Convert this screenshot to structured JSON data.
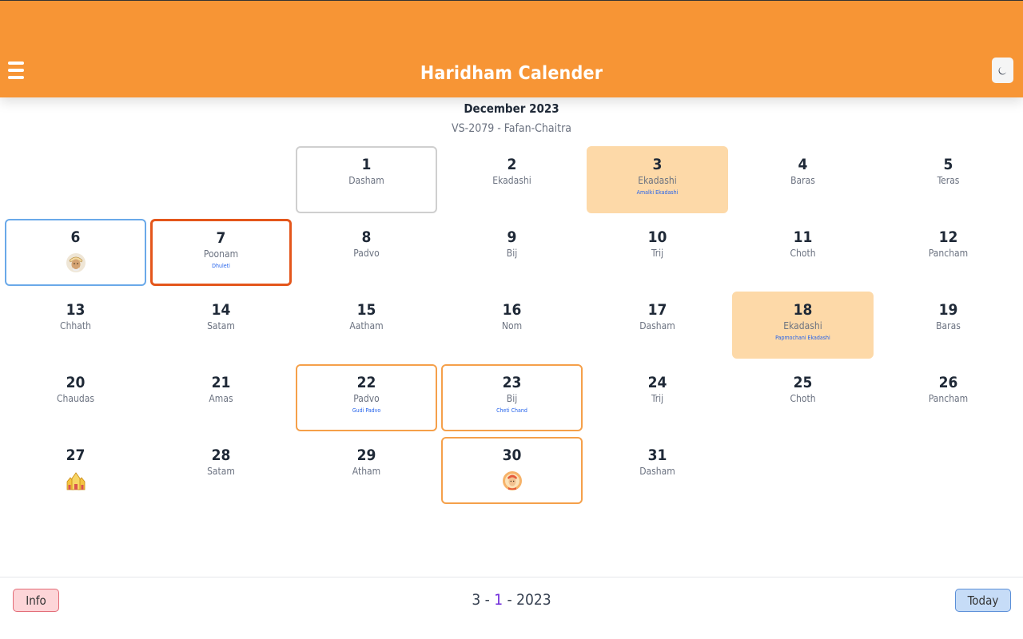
{
  "header": {
    "title": "Haridham Calender"
  },
  "calendar": {
    "month": "December 2023",
    "vs": "VS-2079 - Fafan-Chaitra",
    "days": [
      {
        "num": "1",
        "tithi": "Dasham",
        "event": ""
      },
      {
        "num": "2",
        "tithi": "Ekadashi",
        "event": ""
      },
      {
        "num": "3",
        "tithi": "Ekadashi",
        "event": "Amalki Ekadashi"
      },
      {
        "num": "4",
        "tithi": "Baras",
        "event": ""
      },
      {
        "num": "5",
        "tithi": "Teras",
        "event": ""
      },
      {
        "num": "6",
        "tithi": "",
        "event": ""
      },
      {
        "num": "7",
        "tithi": "Poonam",
        "event": "Dhuleti"
      },
      {
        "num": "8",
        "tithi": "Padvo",
        "event": ""
      },
      {
        "num": "9",
        "tithi": "Bij",
        "event": ""
      },
      {
        "num": "10",
        "tithi": "Trij",
        "event": ""
      },
      {
        "num": "11",
        "tithi": "Choth",
        "event": ""
      },
      {
        "num": "12",
        "tithi": "Pancham",
        "event": ""
      },
      {
        "num": "13",
        "tithi": "Chhath",
        "event": ""
      },
      {
        "num": "14",
        "tithi": "Satam",
        "event": ""
      },
      {
        "num": "15",
        "tithi": "Aatham",
        "event": ""
      },
      {
        "num": "16",
        "tithi": "Nom",
        "event": ""
      },
      {
        "num": "17",
        "tithi": "Dasham",
        "event": ""
      },
      {
        "num": "18",
        "tithi": "Ekadashi",
        "event": "Papmochani Ekadashi"
      },
      {
        "num": "19",
        "tithi": "Baras",
        "event": ""
      },
      {
        "num": "20",
        "tithi": "Chaudas",
        "event": ""
      },
      {
        "num": "21",
        "tithi": "Amas",
        "event": ""
      },
      {
        "num": "22",
        "tithi": "Padvo",
        "event": "Gudi Padvo"
      },
      {
        "num": "23",
        "tithi": "Bij",
        "event": "Cheti Chand"
      },
      {
        "num": "24",
        "tithi": "Trij",
        "event": ""
      },
      {
        "num": "25",
        "tithi": "Choth",
        "event": ""
      },
      {
        "num": "26",
        "tithi": "Pancham",
        "event": ""
      },
      {
        "num": "27",
        "tithi": "",
        "event": ""
      },
      {
        "num": "28",
        "tithi": "Satam",
        "event": ""
      },
      {
        "num": "29",
        "tithi": "Atham",
        "event": ""
      },
      {
        "num": "30",
        "tithi": "",
        "event": ""
      },
      {
        "num": "31",
        "tithi": "Dasham",
        "event": ""
      }
    ]
  },
  "footer": {
    "info_label": "Info",
    "today_label": "Today",
    "date_day": "3",
    "date_sep1": " - ",
    "date_month": "1",
    "date_sep2": " - ",
    "date_year": "2023"
  },
  "colors": {
    "header_bg": "#f79535",
    "ekadashi_bg": "#fdd9a8",
    "today_border": "#e4561b",
    "festival_border": "#f5a04a",
    "event_text": "#2563eb"
  }
}
